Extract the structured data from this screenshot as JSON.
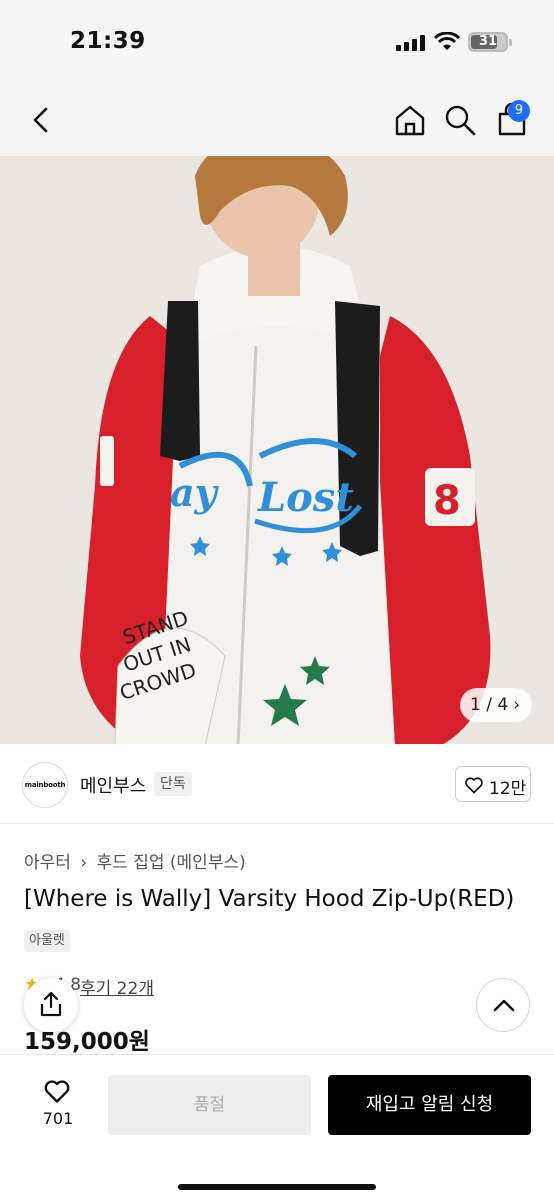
{
  "status_bar": {
    "time": "21:39",
    "battery": "31"
  },
  "nav": {
    "cart_count": "9"
  },
  "gallery": {
    "counter": "1 / 4"
  },
  "hero_art": {
    "patch_text_1": "ay",
    "patch_text_2": "Lost",
    "sleeve_number": "8",
    "pocket_line_1": "STAND",
    "pocket_line_2": "OUT IN",
    "pocket_line_3": "CROWD"
  },
  "brand": {
    "logo_text": "mainbooth",
    "name": "메인부스",
    "exclusive_tag": "단독",
    "like_count": "12만"
  },
  "product": {
    "breadcrumb": [
      "아우터",
      "›",
      "후드 집업 (메인부스)"
    ],
    "title": "[Where is Wally] Varsity Hood Zip-Up(RED)",
    "outlet_tag": "아울렛",
    "rating": "4.8",
    "review_link": "후기 22개",
    "price": "159,000원"
  },
  "bottom_bar": {
    "wish_count": "701",
    "soldout_label": "품절",
    "restock_label": "재입고 알림 신청"
  },
  "colors": {
    "accent": "#1c6ef2",
    "jacket_red": "#d8202a",
    "cta": "#000000"
  }
}
